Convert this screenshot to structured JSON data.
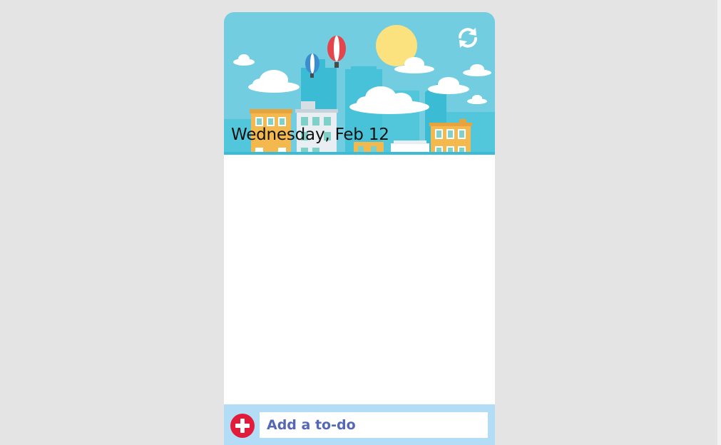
{
  "header": {
    "date_text": "Wednesday, Feb 12",
    "refresh_icon": "refresh-icon"
  },
  "footer": {
    "add_icon": "plus-circle-icon",
    "input_placeholder": "Add a to-do",
    "input_value": ""
  },
  "colors": {
    "sky": "#73cde0",
    "accent_red": "#e31b3a",
    "footer_bg": "#b3dcf7",
    "placeholder_text": "#5568b6",
    "page_bg": "#e5e4e5"
  }
}
